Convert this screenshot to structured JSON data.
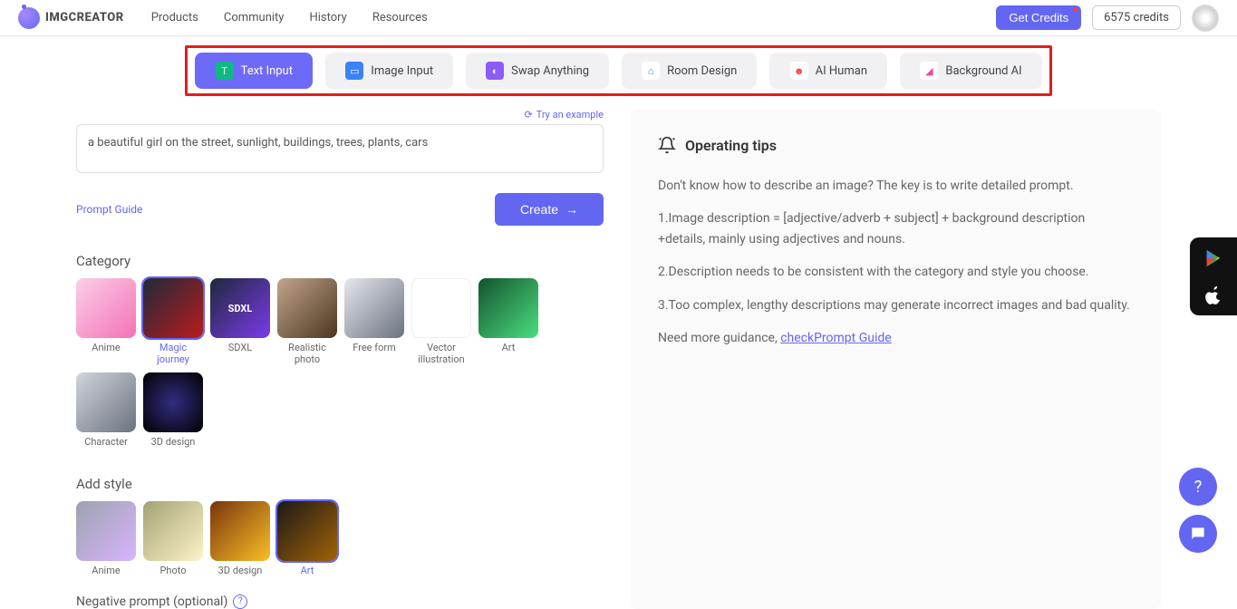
{
  "header": {
    "logo_text": "IMGCREATOR",
    "nav": {
      "products": "Products",
      "community": "Community",
      "history": "History",
      "resources": "Resources"
    },
    "get_credits": "Get Credits",
    "credits_count": "6575 credits"
  },
  "modes": {
    "text_input": "Text Input",
    "image_input": "Image Input",
    "swap": "Swap Anything",
    "room": "Room Design",
    "ai_human": "AI Human",
    "bg_ai": "Background AI"
  },
  "left": {
    "try_example": "Try an example",
    "prompt_value": "a beautiful girl on the street, sunlight, buildings, trees, plants, cars",
    "prompt_guide": "Prompt Guide",
    "create": "Create",
    "category_title": "Category",
    "categories": {
      "anime": "Anime",
      "magic": "Magic journey",
      "sdxl": "SDXL",
      "sdxl_badge": "SDXL",
      "photo": "Realistic photo",
      "free": "Free form",
      "vector": "Vector illustration",
      "art": "Art",
      "character": "Character",
      "d3": "3D design"
    },
    "style_title": "Add style",
    "styles": {
      "anime": "Anime",
      "photo": "Photo",
      "d3": "3D design",
      "art": "Art"
    },
    "negative_title": "Negative prompt (optional)"
  },
  "tips": {
    "title": "Operating tips",
    "p1": "Don't know how to describe an image? The key is to write detailed prompt.",
    "p2": "1.Image description = [adjective/adverb + subject] + background description +details, mainly using adjectives and nouns.",
    "p3": "2.Description needs to be consistent with the category and style you choose.",
    "p4": "3.Too complex, lengthy descriptions may generate incorrect images and bad quality.",
    "p5_prefix": "Need more guidance, ",
    "p5_link": "checkPrompt Guide"
  }
}
